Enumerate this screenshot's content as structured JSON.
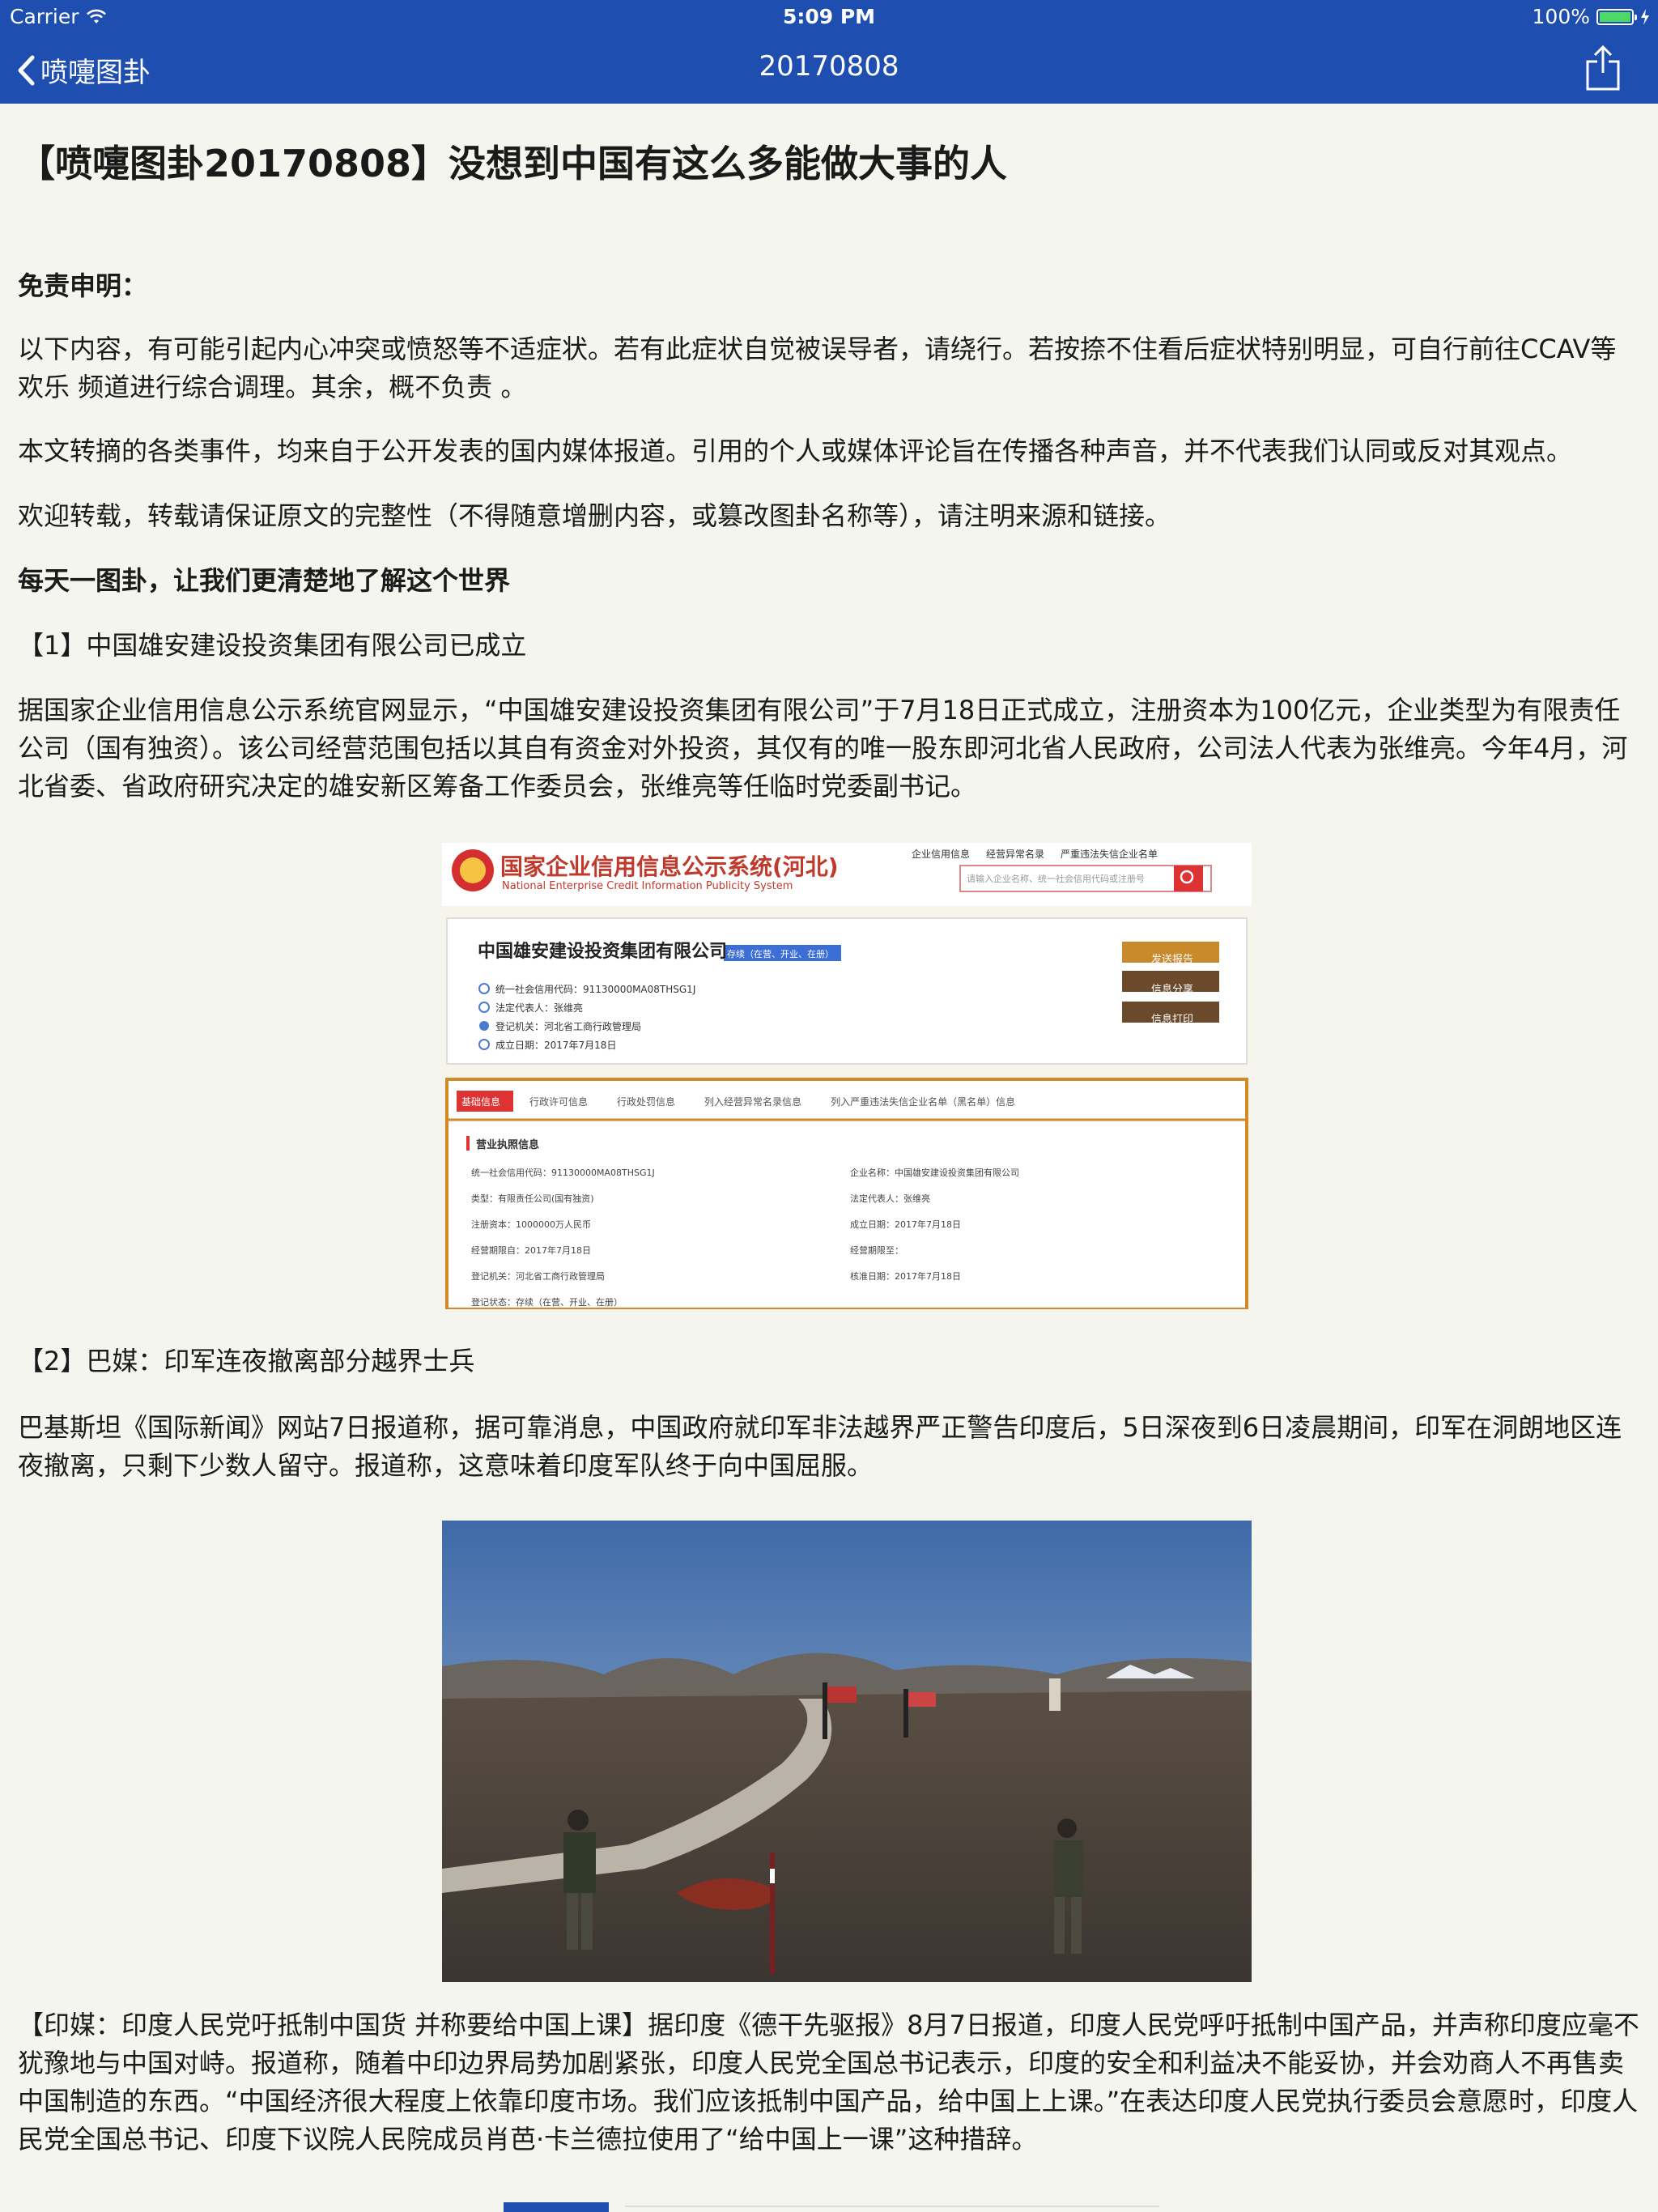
{
  "status_bar": {
    "carrier": "Carrier",
    "time": "5:09 PM",
    "battery": "100%"
  },
  "nav": {
    "back_label": "喷嚏图卦",
    "title": "20170808"
  },
  "article": {
    "title": "【喷嚏图卦20170808】没想到中国有这么多能做大事的人",
    "disclaimer_heading": "免责申明：",
    "disclaimer_p1": "以下内容，有可能引起内心冲突或愤怒等不适症状。若有此症状自觉被误导者，请绕行。若按捺不住看后症状特别明显，可自行前往CCAV等欢乐 频道进行综合调理。其余，概不负责 。",
    "disclaimer_p2": "本文转摘的各类事件，均来自于公开发表的国内媒体报道。引用的个人或媒体评论旨在传播各种声音，并不代表我们认同或反对其观点。",
    "disclaimer_p3": "欢迎转载，转载请保证原文的完整性（不得随意增删内容，或篡改图卦名称等），请注明来源和链接。",
    "slogan": "每天一图卦，让我们更清楚地了解这个世界",
    "item1_heading": "【1】中国雄安建设投资集团有限公司已成立",
    "item1_body": "据国家企业信用信息公示系统官网显示，“中国雄安建设投资集团有限公司”于7月18日正式成立，注册资本为100亿元，企业类型为有限责任公司（国有独资）。该公司经营范围包括以其自有资金对外投资，其仅有的唯一股东即河北省人民政府，公司法人代表为张维亮。今年4月，河北省委、省政府研究决定的雄安新区筹备工作委员会，张维亮等任临时党委副书记。",
    "item2_heading": "【2】巴媒：印军连夜撤离部分越界士兵",
    "item2_body": "巴基斯坦《国际新闻》网站7日报道称，据可靠消息，中国政府就印军非法越界严正警告印度后，5日深夜到6日凌晨期间，印军在洞朗地区连夜撤离，只剩下少数人留守。报道称，这意味着印度军队终于向中国屈服。",
    "item3_body": "【印媒：印度人民党吁抵制中国货 并称要给中国上课】据印度《德干先驱报》8月7日报道，印度人民党呼吁抵制中国产品，并声称印度应毫不犹豫地与中国对峙。报道称，随着中印边界局势加剧紧张，印度人民党全国总书记表示，印度的安全和利益决不能妥协，并会劝商人不再售卖中国制造的东西。“中国经济很大程度上依靠印度市场。我们应该抵制中国产品，给中国上上课。”在表达印度人民党执行委员会意愿时，印度人民党全国总书记、印度下议院人民院成员肖芭·卡兰德拉使用了“给中国上一课”这种措辞。"
  },
  "screenshot1": {
    "site_title": "国家企业信用信息公示系统(河北)",
    "site_subtitle": "National Enterprise Credit Information Publicity System",
    "top_links": [
      "企业信用信息",
      "经营异常名录",
      "严重违法失信企业名单"
    ],
    "search_placeholder": "请输入企业名称、统一社会信用代码或注册号",
    "company_name": "中国雄安建设投资集团有限公司",
    "status_badge": "存续（在营、开业、在册）",
    "info_lines": [
      "统一社会信用代码：91130000MA08THSG1J",
      "法定代表人：张维亮",
      "登记机关：河北省工商行政管理局",
      "成立日期：2017年7月18日"
    ],
    "buttons": [
      "发送报告",
      "信息分享",
      "信息打印"
    ],
    "tabs": [
      "基础信息",
      "行政许可信息",
      "行政处罚信息",
      "列入经营异常名录信息",
      "列入严重违法失信企业名单（黑名单）信息"
    ],
    "section_title": "营业执照信息",
    "left_fields": [
      "统一社会信用代码：91130000MA08THSG1J",
      "类型：有限责任公司(国有独资)",
      "注册资本：1000000万人民币",
      "经营期限自：2017年7月18日",
      "登记机关：河北省工商行政管理局",
      "登记状态：存续（在营、开业、在册）"
    ],
    "right_fields": [
      "企业名称：中国雄安建设投资集团有限公司",
      "法定代表人：张维亮",
      "成立日期：2017年7月18日",
      "经营期限至：",
      "核准日期：2017年7月18日"
    ]
  },
  "photo1": {
    "description_icon": "border-landscape-photo"
  }
}
